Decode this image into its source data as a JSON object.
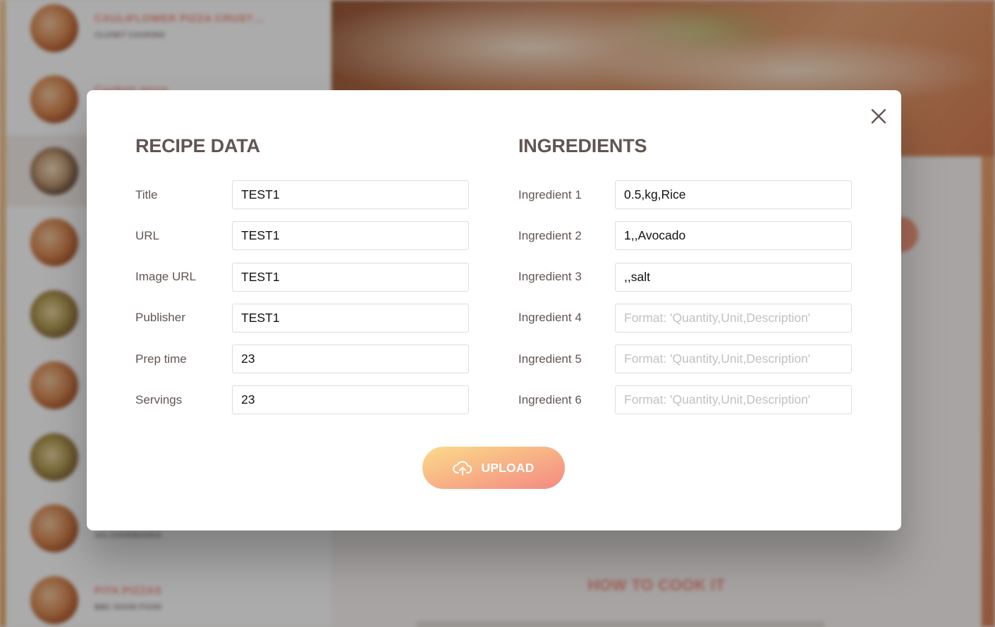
{
  "background": {
    "results": [
      {
        "title": "CAULIFLOWER PIZZA CRUST…",
        "publisher": "Closet Cooking",
        "active": false,
        "tone": "default"
      },
      {
        "title": "Cookstr pizza",
        "publisher": "",
        "active": false,
        "tone": "default"
      },
      {
        "title": "",
        "publisher": "",
        "active": true,
        "tone": "alt"
      },
      {
        "title": "",
        "publisher": "",
        "active": false,
        "tone": "default"
      },
      {
        "title": "",
        "publisher": "",
        "active": false,
        "tone": "green"
      },
      {
        "title": "",
        "publisher": "",
        "active": false,
        "tone": "default"
      },
      {
        "title": "",
        "publisher": "",
        "active": false,
        "tone": "green"
      },
      {
        "title": "",
        "publisher": "101 Cookbooks",
        "active": false,
        "tone": "default"
      },
      {
        "title": "PITA PIZZAS",
        "publisher": "BBC Good Food",
        "active": false,
        "tone": "default"
      }
    ],
    "how_to_heading": "HOW TO COOK IT"
  },
  "modal": {
    "recipe_section": {
      "heading": "RECIPE DATA",
      "fields": [
        {
          "label": "Title",
          "value": "TEST1",
          "placeholder": ""
        },
        {
          "label": "URL",
          "value": "TEST1",
          "placeholder": ""
        },
        {
          "label": "Image URL",
          "value": "TEST1",
          "placeholder": ""
        },
        {
          "label": "Publisher",
          "value": "TEST1",
          "placeholder": ""
        },
        {
          "label": "Prep time",
          "value": "23",
          "placeholder": ""
        },
        {
          "label": "Servings",
          "value": "23",
          "placeholder": ""
        }
      ]
    },
    "ingredients_section": {
      "heading": "INGREDIENTS",
      "fields": [
        {
          "label": "Ingredient 1",
          "value": "0.5,kg,Rice",
          "placeholder": "Format: 'Quantity,Unit,Description'"
        },
        {
          "label": "Ingredient 2",
          "value": "1,,Avocado",
          "placeholder": "Format: 'Quantity,Unit,Description'"
        },
        {
          "label": "Ingredient 3",
          "value": ",,salt",
          "placeholder": "Format: 'Quantity,Unit,Description'"
        },
        {
          "label": "Ingredient 4",
          "value": "",
          "placeholder": "Format: 'Quantity,Unit,Description'"
        },
        {
          "label": "Ingredient 5",
          "value": "",
          "placeholder": "Format: 'Quantity,Unit,Description'"
        },
        {
          "label": "Ingredient 6",
          "value": "",
          "placeholder": "Format: 'Quantity,Unit,Description'"
        }
      ]
    },
    "upload_label": "UPLOAD",
    "icons": {
      "close": "close-icon",
      "upload": "cloud-upload-icon"
    },
    "colors": {
      "accent_start": "#fbdb89",
      "accent_end": "#f48982",
      "heading": "#615551"
    }
  }
}
